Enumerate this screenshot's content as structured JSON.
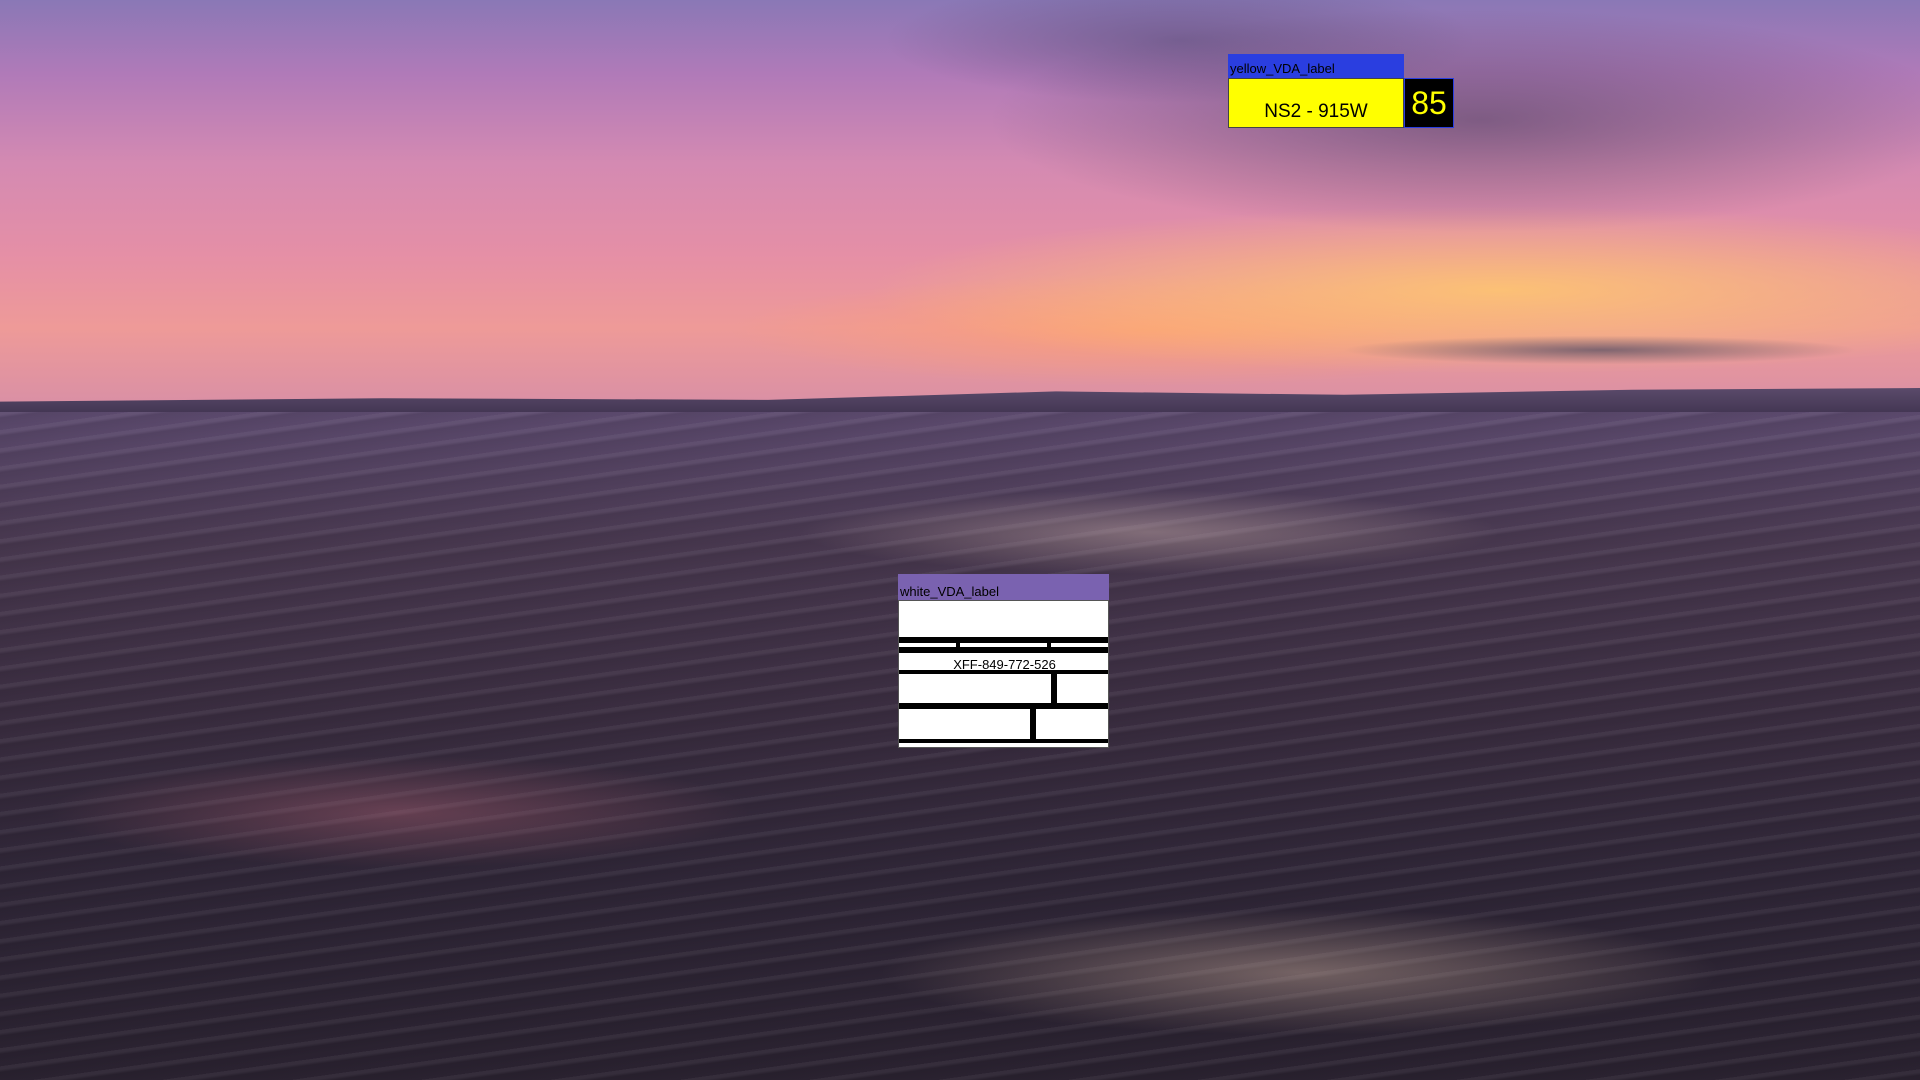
{
  "yellow_label": {
    "title": "yellow_VDA_label",
    "code": "NS2 - 915W",
    "count": "85",
    "colors": {
      "title_bg": "#2a3ee0",
      "body_bg": "#ffff00",
      "count_bg": "#000000",
      "count_text": "#ffff00"
    }
  },
  "white_label": {
    "title": "white_VDA_label",
    "code": "XFF-849-772-526",
    "colors": {
      "title_bg": "#7a62b0",
      "body_bg": "#ffffff"
    }
  }
}
